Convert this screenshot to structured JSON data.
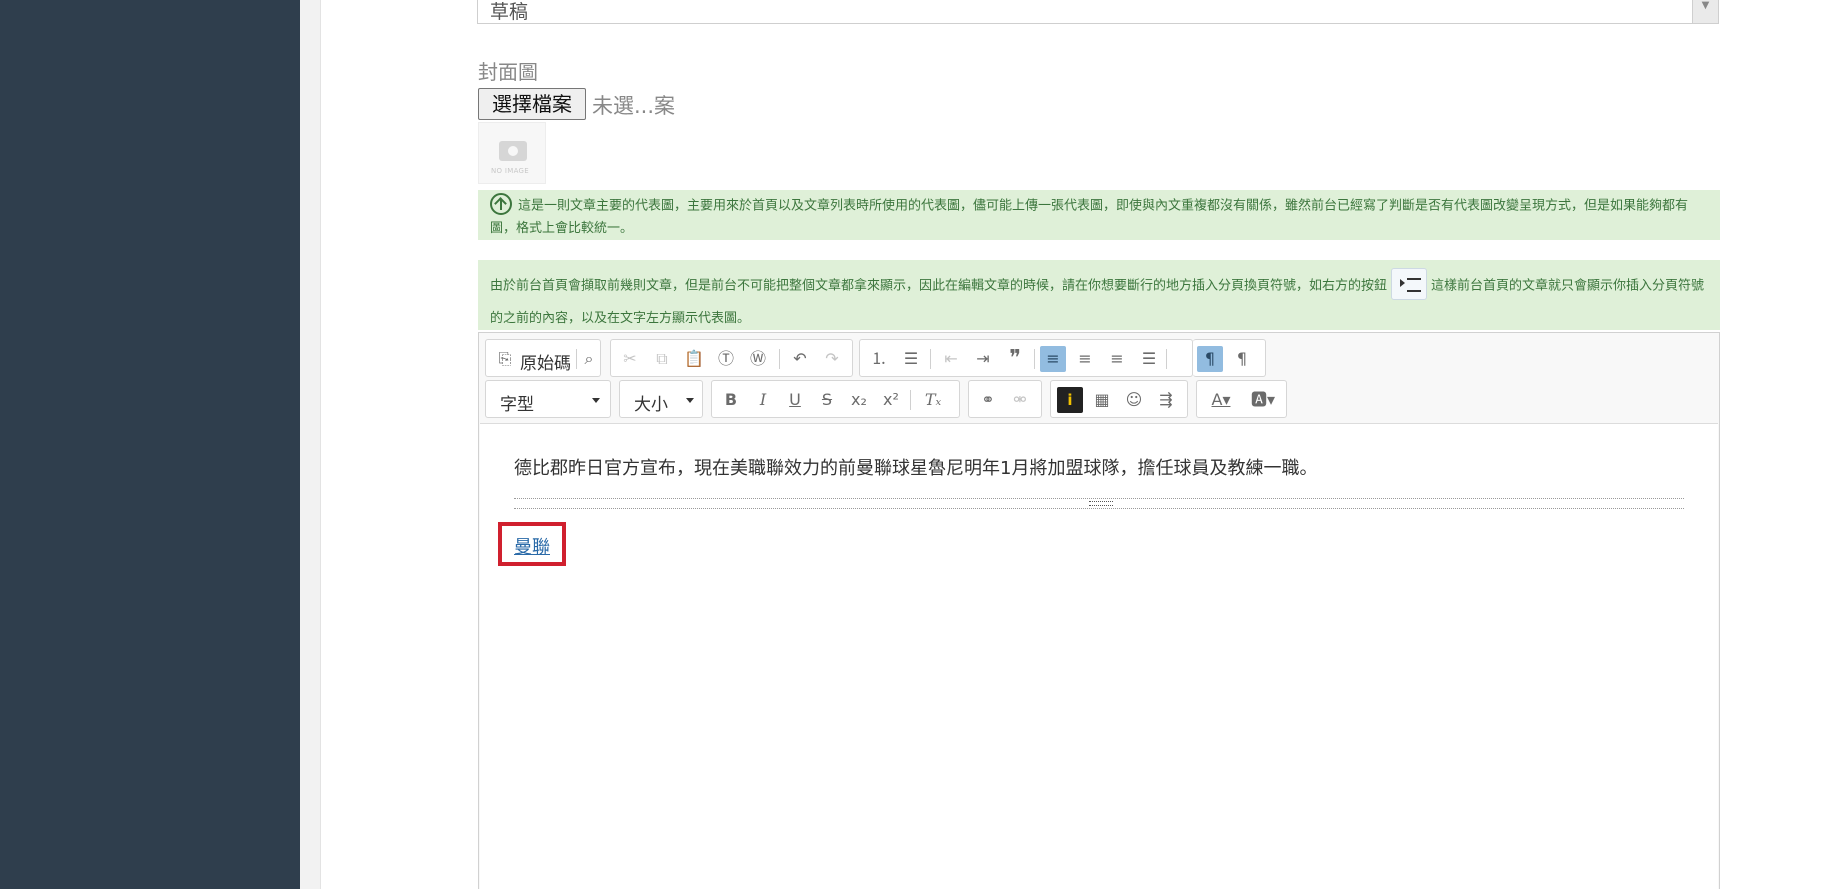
{
  "form": {
    "status_value": "草稿",
    "cover_label": "封面圖",
    "file_button_label": "選擇檔案",
    "file_status": "未選...案",
    "no_image_text": "NO IMAGE"
  },
  "hints": {
    "cover_hint": "這是一則文章主要的代表圖，主要用來於首頁以及文章列表時所使用的代表圖，儘可能上傳一張代表圖，即使與內文重複都沒有關係，雖然前台已經寫了判斷是否有代表圖改變呈現方式，但是如果能夠都有圖，格式上會比較統一。",
    "pagebreak_hint_before": "由於前台首頁會擷取前幾則文章，但是前台不可能把整個文章都拿來顯示，因此在編輯文章的時候，請在你想要斷行的地方插入分頁換頁符號，如右方的按鈕",
    "pagebreak_hint_after": "這樣前台首頁的文章就只會顯示你插入分頁符號的之前的內容，以及在文字左方顯示代表圖。"
  },
  "toolbar": {
    "source_label": "原始碼",
    "font_label": "字型",
    "size_label": "大小"
  },
  "editor": {
    "paragraph": "德比郡昨日官方宣布，現在美職聯效力的前曼聯球星魯尼明年1月將加盟球隊，擔任球員及教練一職。",
    "link_text": "曼聯"
  },
  "colors": {
    "sidebar": "#2f3e4d",
    "hint_bg": "#dff0d8",
    "hint_text": "#3c763d",
    "active_button": "#92bce0",
    "highlight_box": "#d0202e",
    "link": "#2a6aa8"
  }
}
